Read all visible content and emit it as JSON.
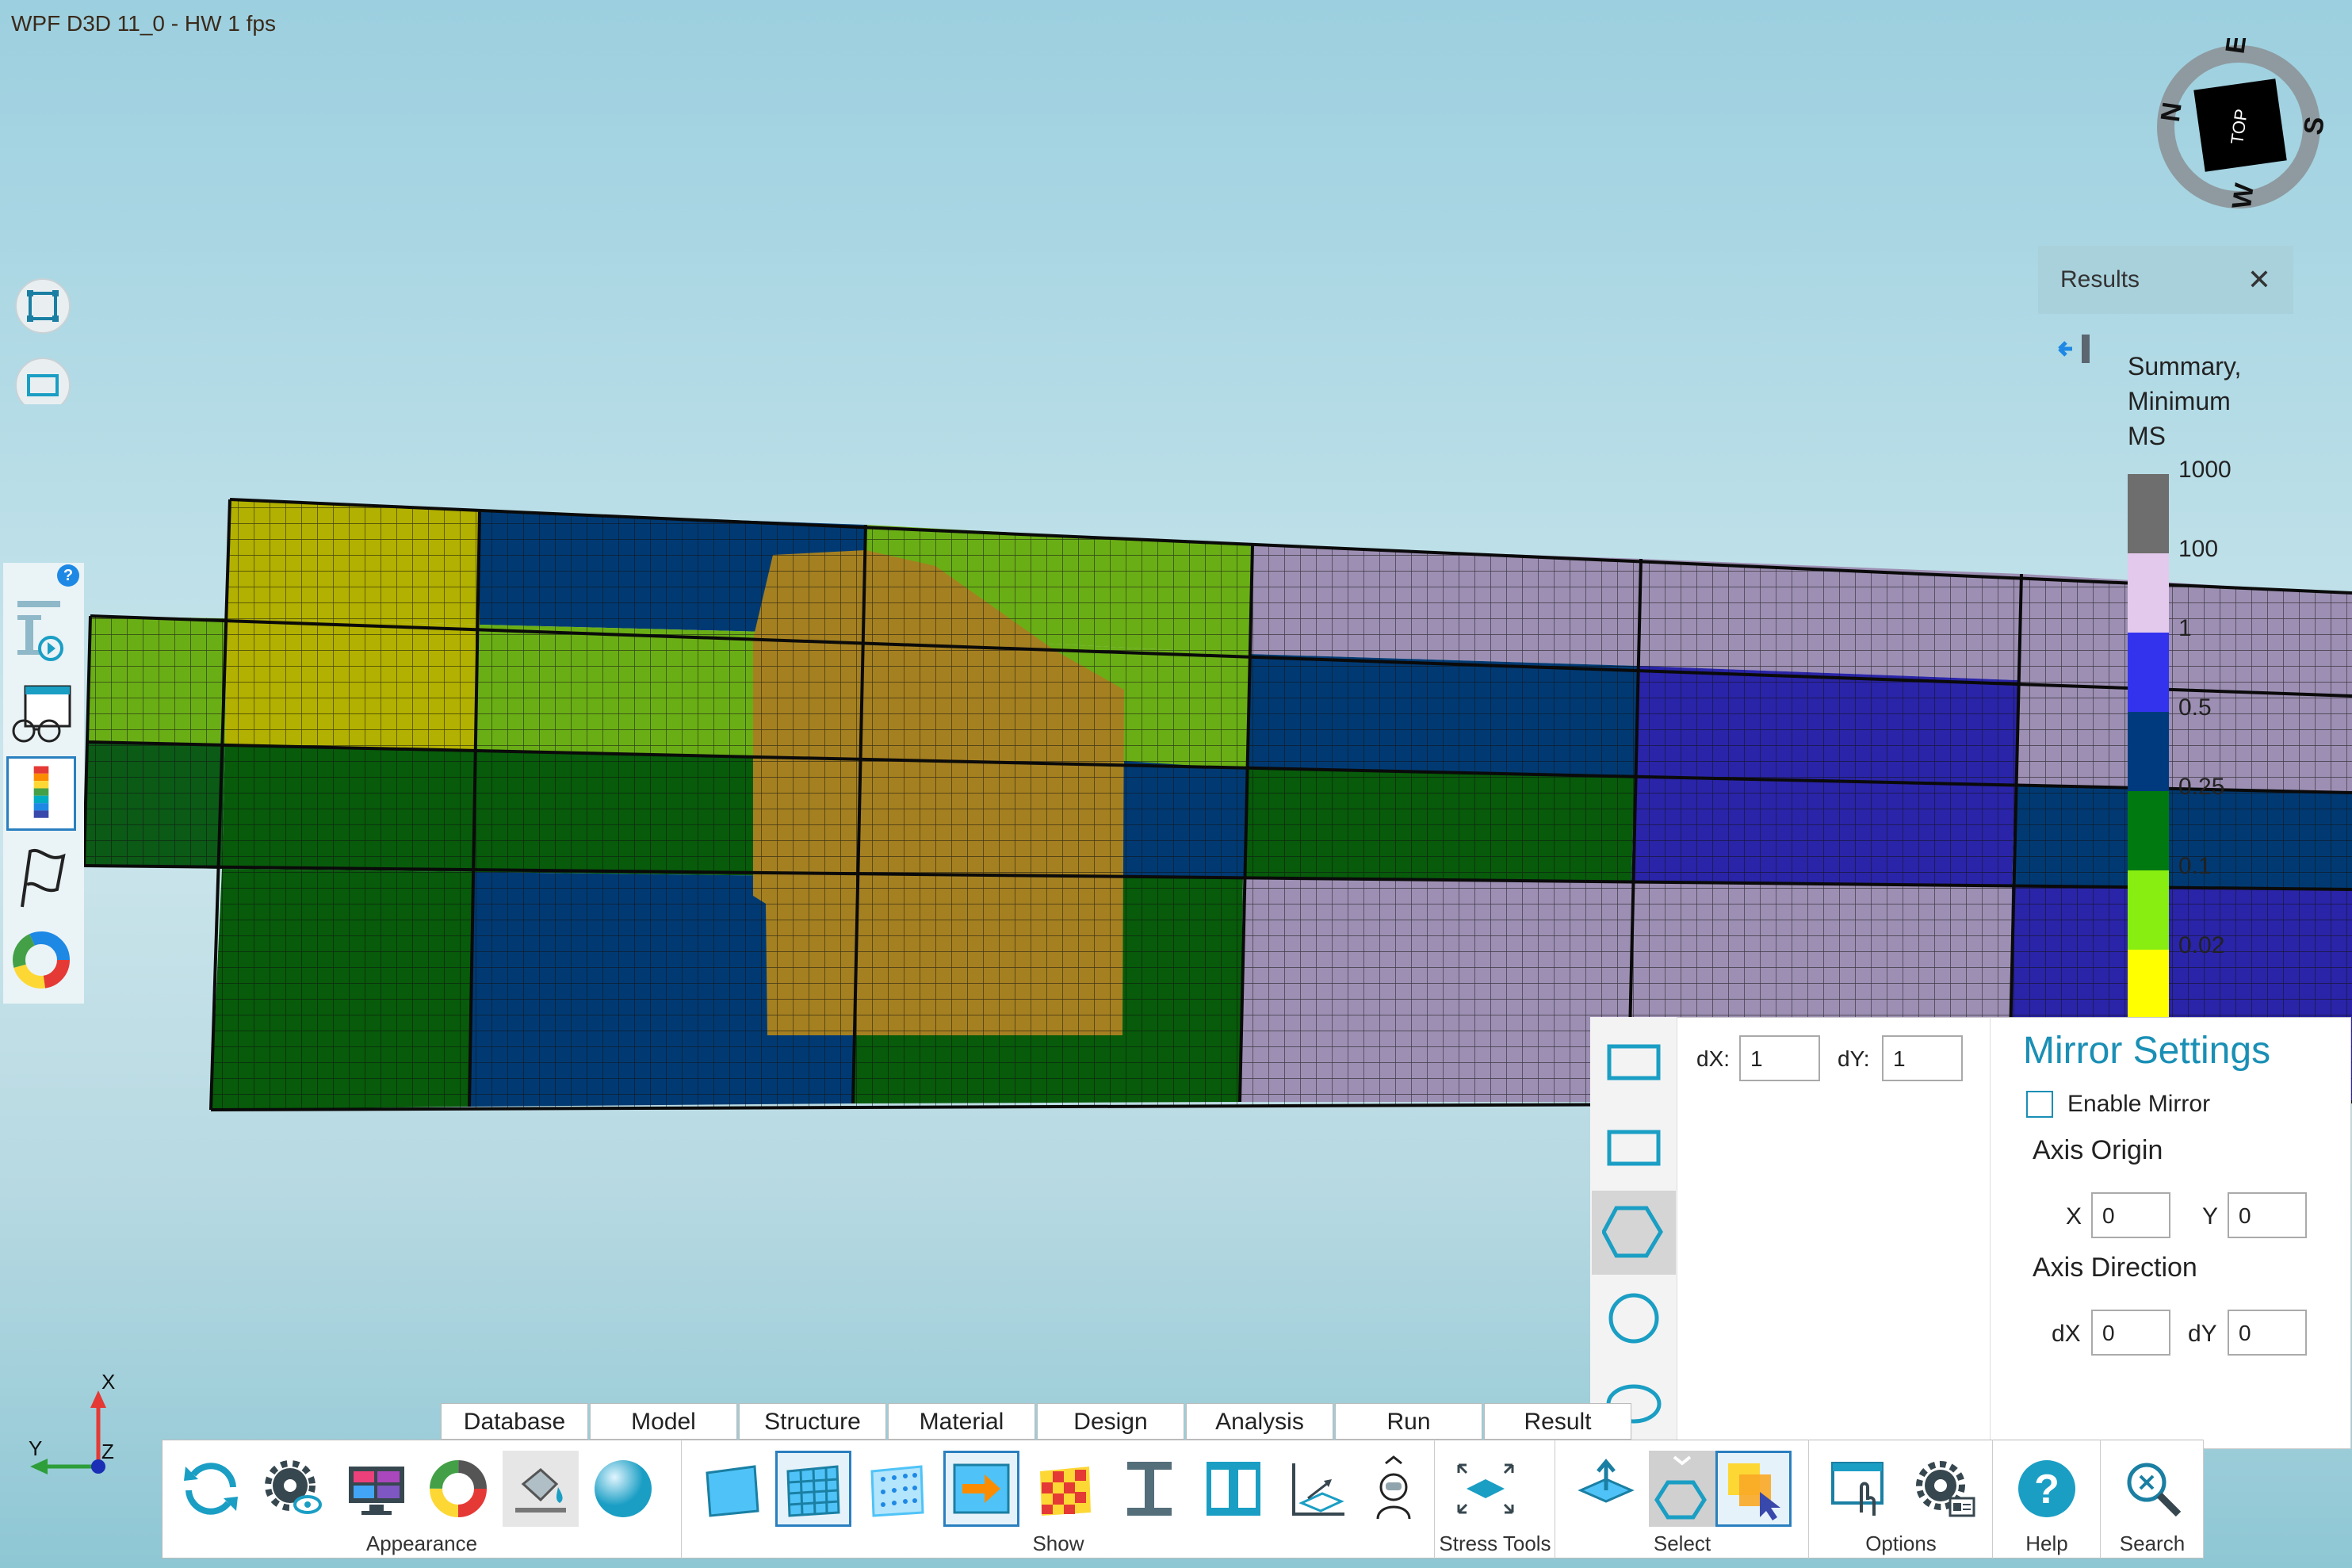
{
  "window": {
    "title": "WPF D3D 11_0 - HW  1 fps"
  },
  "compass": {
    "top_label": "TOP",
    "n": "N",
    "e": "E",
    "s": "S",
    "w": "W"
  },
  "results_panel": {
    "title": "Results",
    "close_icon": "close-icon",
    "collapse_icon": "collapse-left-icon",
    "legend_title_lines": [
      "Summary,",
      "Minimum",
      "MS"
    ],
    "legend": [
      {
        "label": "1000",
        "color": "#6e6e6e"
      },
      {
        "label": "100",
        "color": "#e3c9ec"
      },
      {
        "label": "1",
        "color": "#3333ee"
      },
      {
        "label": "0.5",
        "color": "#003a7e"
      },
      {
        "label": "0.25",
        "color": "#007a10"
      },
      {
        "label": "0.1",
        "color": "#88ee11"
      },
      {
        "label": "0.02",
        "color": "#ffff00"
      }
    ]
  },
  "left_tools": {
    "fit_icon": "fit-view-icon",
    "rect_icon": "rectangle-view-icon",
    "help": "?",
    "panel_icons": [
      "beam-tool-icon",
      "view-glasses-icon",
      "color-scale-icon",
      "flag-icon",
      "donut-chart-icon"
    ]
  },
  "mesh_colors": {
    "yellow": "#b2b000",
    "navy": "#013a73",
    "lime": "#6aae16",
    "gold": "#a58020",
    "green": "#075b0a",
    "purple": "#9d8fb3",
    "blue": "#2a24a8",
    "darkgreen": "#0b5a16"
  },
  "shape_panel": {
    "shapes": [
      "rectangle-select-icon",
      "rectangle-select-icon",
      "hexagon-select-icon",
      "circle-select-icon",
      "ellipse-select-icon"
    ],
    "dx_label": "dX:",
    "dx_value": "1",
    "dy_label": "dY:",
    "dy_value": "1"
  },
  "mirror": {
    "title": "Mirror Settings",
    "enable_label": "Enable Mirror",
    "axis_origin": "Axis Origin",
    "x_label": "X",
    "x_value": "0",
    "y_label": "Y",
    "y_value": "0",
    "axis_direction": "Axis Direction",
    "dx_label": "dX",
    "dx_value": "0",
    "dy_label": "dY",
    "dy_value": "0"
  },
  "tabs": [
    "Database",
    "Model",
    "Structure",
    "Material",
    "Design",
    "Analysis",
    "Run",
    "Result"
  ],
  "ribbon": {
    "groups": [
      {
        "label": "Appearance"
      },
      {
        "label": "Show"
      },
      {
        "label": "Stress Tools"
      },
      {
        "label": "Select"
      },
      {
        "label": "Options"
      },
      {
        "label": "Help"
      },
      {
        "label": "Search"
      }
    ]
  },
  "axes": {
    "x": "X",
    "y": "Y",
    "z": "Z"
  }
}
